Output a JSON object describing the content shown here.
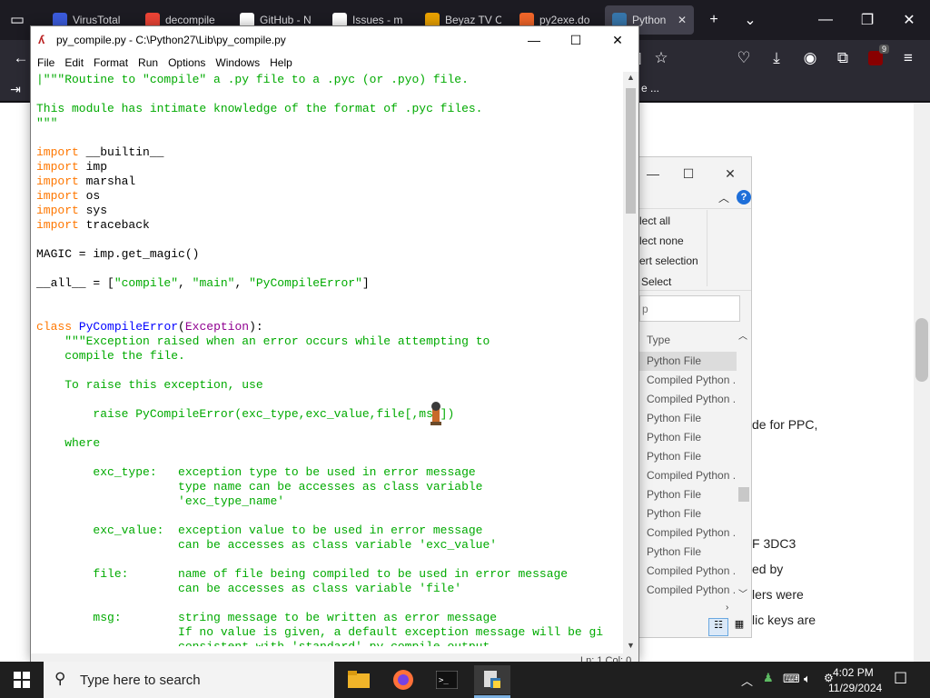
{
  "browser": {
    "tabs": [
      {
        "title": "VirusTotal",
        "color": "#3b5bdb"
      },
      {
        "title": "decompile",
        "color": "#ea4335"
      },
      {
        "title": "GitHub - N",
        "color": "#ffffff"
      },
      {
        "title": "Issues - m",
        "color": "#ffffff"
      },
      {
        "title": "Beyaz TV C",
        "color": "#e8a000"
      },
      {
        "title": "py2exe.do",
        "color": "#f06529"
      },
      {
        "title": "Python",
        "color": "#3776ab"
      }
    ],
    "bookmark_fragment": "e ...",
    "extension_badge": "9"
  },
  "webpage": {
    "fragments": [
      "de for PPC,",
      "F 3DC3",
      "ed by",
      "lers were",
      "lic keys are"
    ]
  },
  "explorer": {
    "menu": [
      "lect all",
      "lect none",
      "ert selection",
      "Select"
    ],
    "search_placeholder": "p",
    "column_header": "Type",
    "rows": [
      "Python File",
      "Compiled Python ...",
      "Compiled Python ...",
      "Python File",
      "Python File",
      "Python File",
      "Compiled Python ...",
      "Python File",
      "Python File",
      "Compiled Python ...",
      "Python File",
      "Compiled Python ...",
      "Compiled Python ..."
    ]
  },
  "idle": {
    "title": "py_compile.py - C:\\Python27\\Lib\\py_compile.py",
    "menu": [
      "File",
      "Edit",
      "Format",
      "Run",
      "Options",
      "Windows",
      "Help"
    ],
    "status": "Ln: 1 Col: 0"
  },
  "taskbar": {
    "search_placeholder": "Type here to search",
    "time": "4:02 PM",
    "date": "11/29/2024"
  }
}
